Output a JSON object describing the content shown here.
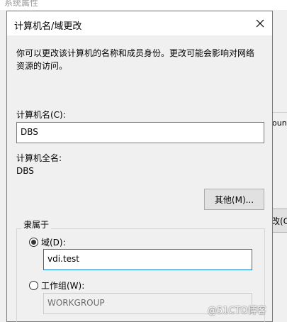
{
  "background": {
    "title": "系统属性",
    "partial_text": "ount",
    "partial_button": "改(C)"
  },
  "dialog": {
    "title": "计算机名/域更改",
    "description": "你可以更改该计算机的名称和成员身份。更改可能会影响对网络资源的访问。",
    "computer_name_label": "计算机名(C):",
    "computer_name_value": "DBS",
    "full_name_label": "计算机全名:",
    "full_name_value": "DBS",
    "more_button": "其他(M)...",
    "member_of": {
      "legend": "隶属于",
      "domain_label": "域(D):",
      "domain_value": "vdi.test",
      "domain_selected": true,
      "workgroup_label": "工作组(W):",
      "workgroup_value": "WORKGROUP",
      "workgroup_selected": false
    }
  },
  "watermark": "@51CTO博客"
}
